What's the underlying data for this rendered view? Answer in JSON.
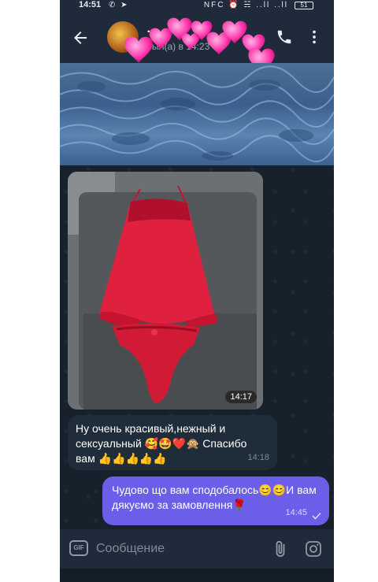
{
  "status_bar": {
    "time": "14:51",
    "left_icons": "✆ ➤",
    "right_icons": "NFC ⏰ ☵ ..ll ..ll",
    "battery": "51"
  },
  "header": {
    "title": "…",
    "subtitle": "был(а) в 14:23"
  },
  "messages": [
    {
      "type": "image",
      "time": "14:17",
      "direction": "incoming"
    },
    {
      "type": "text",
      "direction": "incoming",
      "text": "Ну очень красивый,нежный и сексуальный 🥰🤩❤️🙊 Спасибо вам 👍👍👍👍👍",
      "time": "14:18"
    },
    {
      "type": "text",
      "direction": "outgoing",
      "text": "Чудово що вам сподобалось😊😊И вам дякуємо за замовлення🌹",
      "time": "14:45"
    }
  ],
  "input": {
    "placeholder": "Сообщение",
    "gif_label": "GIF"
  },
  "colors": {
    "header_bg": "#1f2b3a",
    "chat_bg": "#16212b",
    "incoming_bubble": "#1f2c3a",
    "outgoing_bubble": "#6b5ee8"
  }
}
